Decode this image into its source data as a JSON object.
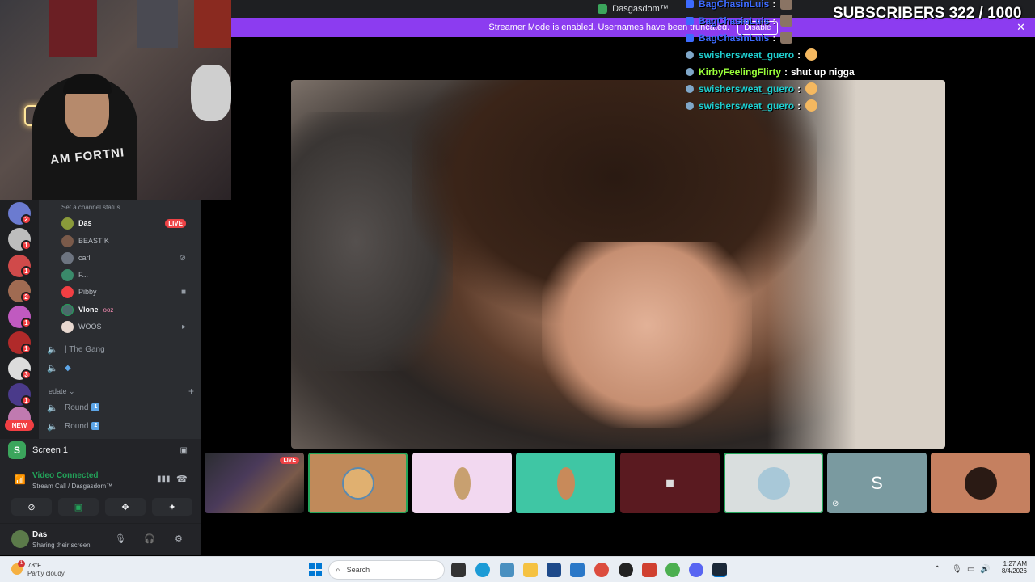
{
  "window": {
    "title": "Dasgasdom™"
  },
  "banner": {
    "text": "Streamer Mode is enabled. Usernames have been truncated.",
    "disable_label": "Disable"
  },
  "overlay": {
    "subscribers": "SUBSCRIBERS 322 / 1000"
  },
  "webcam": {
    "shirt_text": "AM FORTNI"
  },
  "chat": [
    {
      "user": "BagChasinLuis",
      "text": "",
      "color": "#3d6bff"
    },
    {
      "user": "BagChasinLuis",
      "text": "",
      "color": "#3d6bff"
    },
    {
      "user": "BagChasinLuis",
      "text": "",
      "color": "#3d6bff"
    },
    {
      "user": "swishersweat_guero",
      "text": "",
      "color": "#1fcfd0"
    },
    {
      "user": "KirbyFeelingFlirty",
      "text": "shut up nigga",
      "color": "#9aff3a"
    },
    {
      "user": "swishersweat_guero",
      "text": "",
      "color": "#1fcfd0"
    },
    {
      "user": "swishersweat_guero",
      "text": "",
      "color": "#1fcfd0"
    }
  ],
  "channel": {
    "status_placeholder": "Set a channel status",
    "members": [
      {
        "name": "Das",
        "live": "LIVE",
        "bold": true
      },
      {
        "name": "BEAST K"
      },
      {
        "name": "carl"
      },
      {
        "name": "F..."
      },
      {
        "name": "Pibby"
      },
      {
        "name": "Vlone",
        "extra": "ooz",
        "bold": true
      },
      {
        "name": "WOOS"
      }
    ],
    "voice_channels": [
      {
        "name": "| The Gang"
      },
      {
        "name": ""
      }
    ],
    "category": "edate",
    "rounds": [
      {
        "name": "Round",
        "num": "1"
      },
      {
        "name": "Round",
        "num": "2"
      }
    ]
  },
  "servers": {
    "counts": [
      "2",
      "1",
      "1",
      "2",
      "1",
      "1",
      "3",
      "1"
    ],
    "new_label": "NEW"
  },
  "screen_panel": {
    "title": "Screen 1",
    "connection": "Video Connected",
    "call": "Stream Call / Dasgasdom™",
    "user": {
      "name": "Das",
      "status": "Sharing their screen"
    }
  },
  "strip": {
    "live_label": "LIVE",
    "letter": "S"
  },
  "taskbar": {
    "temp": "78°F",
    "condition": "Partly cloudy",
    "weather_badge": "1",
    "search_placeholder": "Search",
    "time": "1:27 AM",
    "date": "8/4/2026"
  },
  "colors": {
    "accent": "#8c3cf0",
    "live": "#ed4245",
    "green": "#23a55a"
  }
}
